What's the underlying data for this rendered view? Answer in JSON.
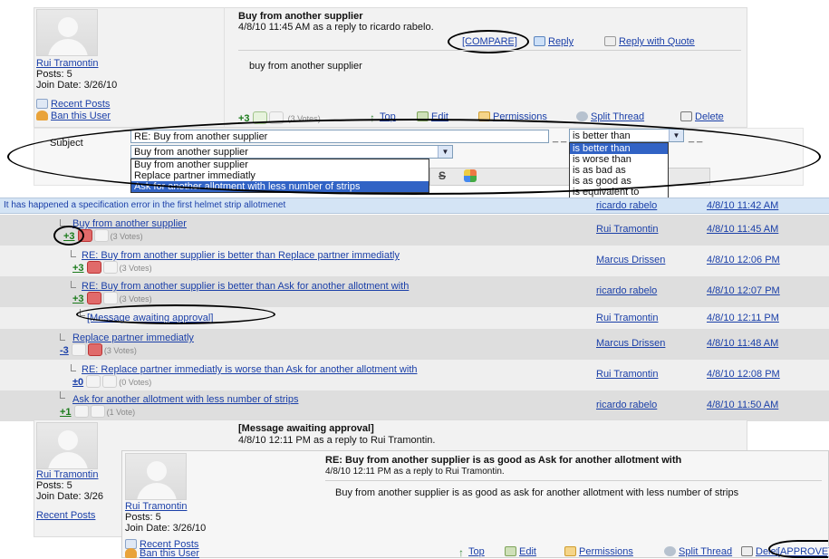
{
  "post1": {
    "title": "Buy from another supplier",
    "meta": "4/8/10 11:45 AM as a reply to ricardo rabelo.",
    "compare": "[COMPARE]",
    "reply": "Reply",
    "reply_quote": "Reply with Quote",
    "body": "buy from another supplier",
    "author": "Rui Tramontin",
    "posts": "Posts: 5",
    "join": "Join Date: 3/26/10",
    "recent": "Recent Posts",
    "ban": "Ban this User",
    "score": "+3",
    "votes": "(3 Votes)",
    "top": "Top",
    "edit": "Edit",
    "permissions": "Permissions",
    "split": "Split Thread",
    "delete": "Delete"
  },
  "editor": {
    "subject_label": "Subject",
    "subject_value": "RE: Buy from another supplier",
    "dash1": "_ _",
    "relation_value": "is better than",
    "dash2": "_ _",
    "target_value": "Buy from another supplier",
    "target_options": [
      "Buy from another supplier",
      "Replace partner immediatly",
      "Ask for another allotment with less number of strips"
    ],
    "relation_options": [
      "is better than",
      "is worse than",
      "is as bad as",
      "is as good as",
      "is equivalent to"
    ],
    "toolbar_s": "S"
  },
  "tree": {
    "header_title": "It has happened a specification error in the first helmet strip allotmenet",
    "header_author": "ricardo rabelo",
    "header_date": "4/8/10 11:42 AM",
    "rows": [
      {
        "title": "Buy from another supplier",
        "score": "+3",
        "votes": "(3 Votes)",
        "author": "Rui Tramontin",
        "date": "4/8/10 11:45 AM"
      },
      {
        "title": "RE: Buy from another supplier is better than Replace partner immediatly",
        "score": "+3",
        "votes": "(3 Votes)",
        "author": "Marcus Drissen",
        "date": "4/8/10 12:06 PM"
      },
      {
        "title": "RE: Buy from another supplier is better than Ask for another allotment with",
        "score": "+3",
        "votes": "(3 Votes)",
        "author": "ricardo rabelo",
        "date": "4/8/10 12:07 PM"
      },
      {
        "title": "[Message awaiting approval]",
        "author": "Rui Tramontin",
        "date": "4/8/10 12:11 PM"
      },
      {
        "title": "Replace partner immediatly",
        "score": "-3",
        "votes": "(3 Votes)",
        "author": "Marcus Drissen",
        "date": "4/8/10 11:48 AM"
      },
      {
        "title": "RE: Replace partner immediatly is worse than Ask for another allotment with",
        "score": "±0",
        "votes": "(0 Votes)",
        "author": "Rui Tramontin",
        "date": "4/8/10 12:08 PM"
      },
      {
        "title": "Ask for another allotment with less number of strips",
        "score": "+1",
        "votes": "(1 Vote)",
        "author": "ricardo rabelo",
        "date": "4/8/10 11:50 AM"
      }
    ]
  },
  "post2": {
    "title": "[Message awaiting approval]",
    "meta": "4/8/10 12:11 PM as a reply to Rui Tramontin.",
    "author": "Rui Tramontin",
    "posts": "Posts: 5",
    "join": "Join Date: 3/26",
    "recent": "Recent Posts"
  },
  "post3": {
    "title": "RE: Buy from another supplier is as good as Ask for another allotment with",
    "meta": "4/8/10 12:11 PM as a reply to Rui Tramontin.",
    "body": "Buy from another supplier is as good as ask for another allotment with less number of strips",
    "author": "Rui Tramontin",
    "posts": "Posts: 5",
    "join": "Join Date: 3/26/10",
    "recent": "Recent Posts",
    "ban": "Ban this User",
    "top": "Top",
    "edit": "Edit",
    "permissions": "Permissions",
    "split": "Split Thread",
    "delete": "Delete",
    "approve": "[APPROVE]"
  }
}
